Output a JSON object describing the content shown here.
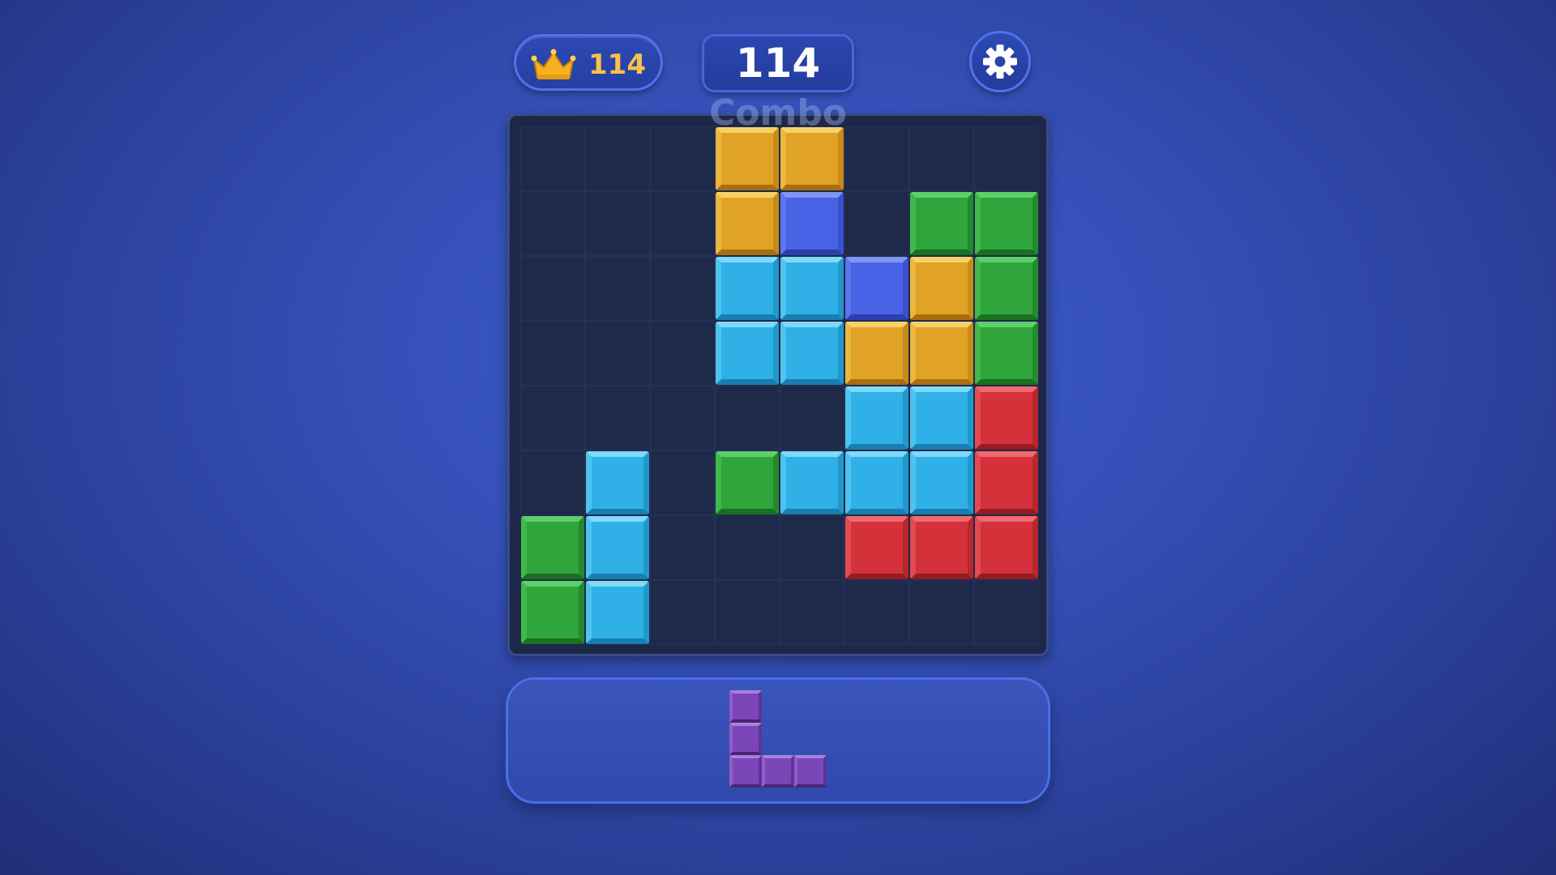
{
  "hud": {
    "best_score": "114",
    "score": "114",
    "combo_label": "Combo",
    "crown_icon": "crown-icon",
    "settings_icon": "gear-icon"
  },
  "colors": {
    "yellow": "#e0a326",
    "blue": "#4a62e6",
    "cyan": "#2fb0e6",
    "green": "#2fa53b",
    "red": "#d5313a",
    "purple": "#7b46b8",
    "empty": "#1f2a4b"
  },
  "board": {
    "rows": 8,
    "cols": 8,
    "cells": [
      [
        "",
        "",
        "",
        "yellow",
        "yellow",
        "",
        "",
        ""
      ],
      [
        "",
        "",
        "",
        "yellow",
        "blue",
        "",
        "green",
        "green"
      ],
      [
        "",
        "",
        "",
        "cyan",
        "cyan",
        "blue",
        "yellow",
        "green"
      ],
      [
        "",
        "",
        "",
        "cyan",
        "cyan",
        "yellow",
        "yellow",
        "green"
      ],
      [
        "",
        "",
        "",
        "",
        "",
        "cyan",
        "cyan",
        "red"
      ],
      [
        "",
        "cyan",
        "",
        "green",
        "cyan",
        "cyan",
        "cyan",
        "red"
      ],
      [
        "green",
        "cyan",
        "",
        "",
        "",
        "red",
        "red",
        "red"
      ],
      [
        "green",
        "cyan",
        "",
        "",
        "",
        "",
        "",
        ""
      ]
    ]
  },
  "tray": {
    "pieces": [
      {
        "color": "purple",
        "shape": [
          [
            0,
            0
          ],
          [
            1,
            0
          ],
          [
            2,
            0
          ],
          [
            2,
            1
          ],
          [
            2,
            2
          ]
        ]
      }
    ]
  }
}
